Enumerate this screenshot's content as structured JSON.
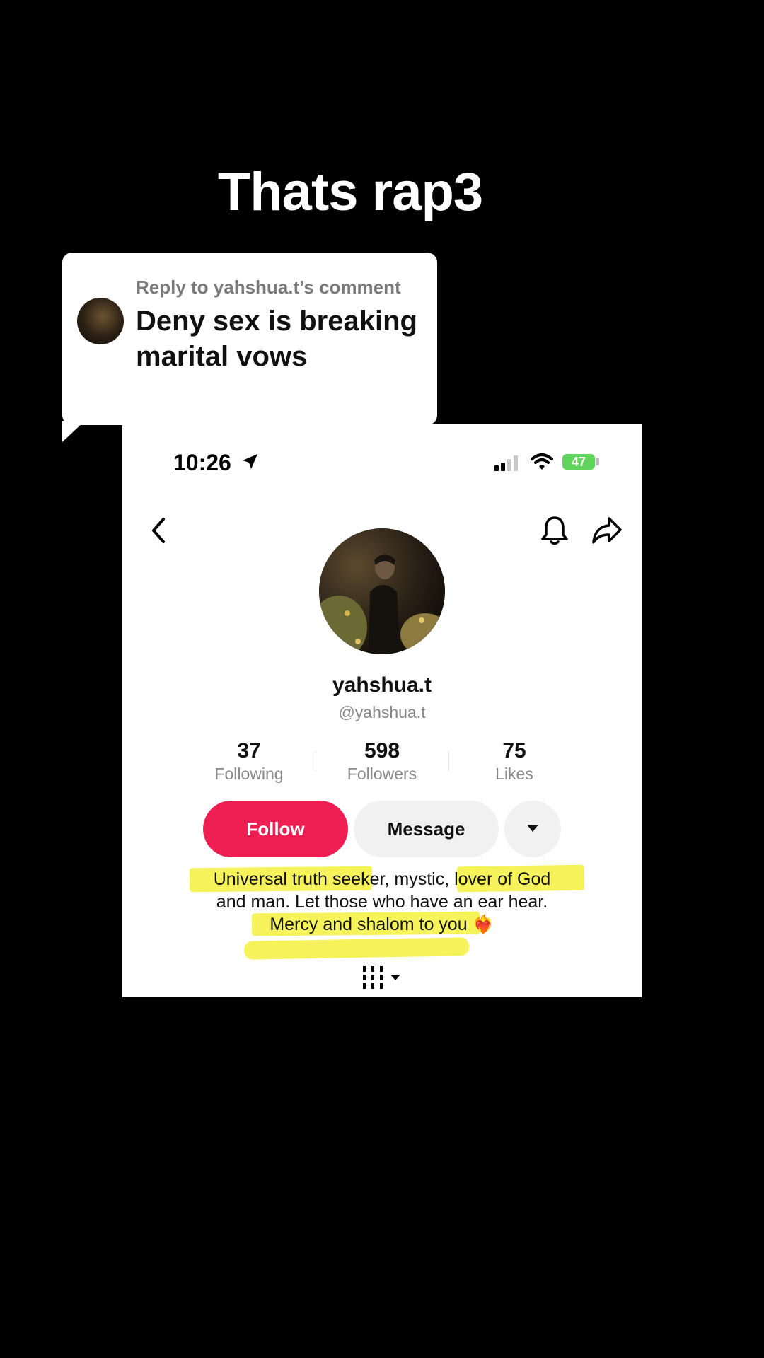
{
  "video": {
    "caption": "Thats rap3"
  },
  "reply_card": {
    "header": "Reply to yahshua.t’s comment",
    "text": "Deny sex is breaking marital vows"
  },
  "status_bar": {
    "time": "10:26",
    "battery": "47"
  },
  "profile": {
    "display_name": "yahshua.t",
    "handle": "@yahshua.t",
    "stats": [
      {
        "value": "37",
        "label": "Following"
      },
      {
        "value": "598",
        "label": "Followers"
      },
      {
        "value": "75",
        "label": "Likes"
      }
    ],
    "follow_label": "Follow",
    "message_label": "Message",
    "bio": [
      "Universal truth seeker, mystic, lover of God",
      "and man. Let those who have an ear hear.",
      "Mercy and shalom to you ❤️‍🔥"
    ],
    "highlight_color": "#f6f35a",
    "follow_color": "#ee1d52"
  }
}
